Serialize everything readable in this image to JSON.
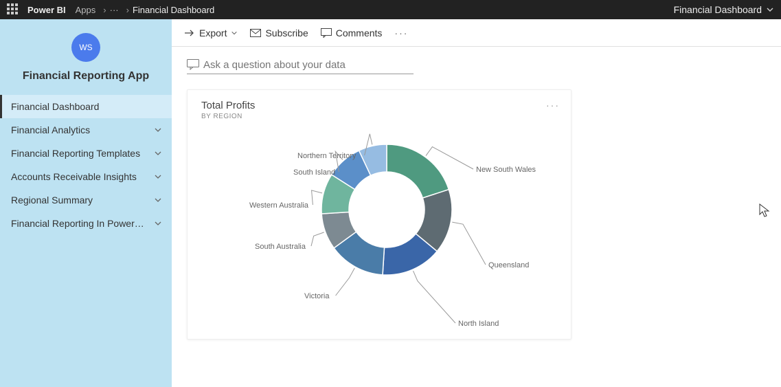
{
  "topbar": {
    "brand": "Power BI",
    "crumb1": "Apps",
    "crumb2": "Financial Dashboard",
    "selector": "Financial Dashboard"
  },
  "sidebar": {
    "avatar": "WS",
    "app_name": "Financial Reporting App",
    "items": [
      {
        "label": "Financial Dashboard",
        "expandable": false
      },
      {
        "label": "Financial Analytics",
        "expandable": true
      },
      {
        "label": "Financial Reporting Templates",
        "expandable": true
      },
      {
        "label": "Accounts Receivable Insights",
        "expandable": true
      },
      {
        "label": "Regional Summary",
        "expandable": true
      },
      {
        "label": "Financial Reporting In Power…",
        "expandable": true
      }
    ]
  },
  "toolbar": {
    "export": "Export",
    "subscribe": "Subscribe",
    "comments": "Comments"
  },
  "qa": {
    "placeholder": "Ask a question about your data"
  },
  "tile": {
    "title": "Total Profits",
    "subtitle": "BY REGION",
    "more": "···"
  },
  "chart_data": {
    "type": "pie",
    "title": "Total Profits",
    "subtitle": "BY REGION",
    "series": [
      {
        "name": "New South Wales",
        "value": 20,
        "color": "#4F9A80"
      },
      {
        "name": "Queensland",
        "value": 16,
        "color": "#5E6B72"
      },
      {
        "name": "North Island",
        "value": 15,
        "color": "#3A66A8"
      },
      {
        "name": "Victoria",
        "value": 14,
        "color": "#4A7CA8"
      },
      {
        "name": "South Australia",
        "value": 9,
        "color": "#7D8A92"
      },
      {
        "name": "Western Australia",
        "value": 10,
        "color": "#6FB59E"
      },
      {
        "name": "South Island",
        "value": 9,
        "color": "#5B8FC9"
      },
      {
        "name": "Northern Territory",
        "value": 7,
        "color": "#96BCE2"
      }
    ]
  }
}
